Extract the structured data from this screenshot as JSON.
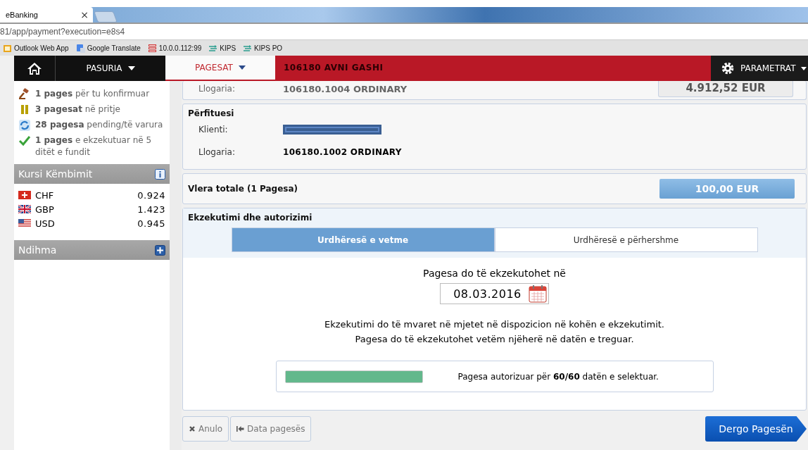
{
  "browser": {
    "tabs": [
      {
        "title": "eBanking",
        "close": "×",
        "selected": true
      }
    ],
    "url": "81/app/payment?execution=e8s4",
    "bookmarks": [
      {
        "label": "Outlook Web App",
        "kind": "mail"
      },
      {
        "label": "Google Translate",
        "kind": "translate"
      },
      {
        "label": "10.0.0.112:99",
        "kind": "server"
      },
      {
        "label": "KIPS",
        "kind": "kips"
      },
      {
        "label": "KIPS PO",
        "kind": "kips"
      }
    ]
  },
  "nav": {
    "items": [
      {
        "label": "PASURIA",
        "selected": false
      },
      {
        "label": "PAGESAT",
        "selected": true
      }
    ],
    "settings": "PARAMETRAT"
  },
  "sidebar": {
    "summary": [
      {
        "text": "**1 pages** për tu konfirmuar",
        "kind": "gavel"
      },
      {
        "text": "**3 pagesat** në pritje",
        "kind": "pause"
      },
      {
        "text": "**28 pagesa** pending/të varura",
        "kind": "sync"
      },
      {
        "text": "**1 pages** e ekzekutuar në 5 ditët e fundit",
        "kind": "check"
      }
    ],
    "rates": {
      "title": "Kursi Këmbimit",
      "rows": [
        {
          "currency": "CHF",
          "rate": "0.924",
          "kind": "ch"
        },
        {
          "currency": "GBP",
          "rate": "1.423",
          "kind": "gb"
        },
        {
          "currency": "USD",
          "rate": "0.945",
          "kind": "us"
        }
      ]
    },
    "help": {
      "title": "Ndihma"
    }
  },
  "payer": {
    "client": "106180 AVNI GASHI",
    "account_label": "Llogaria:",
    "account": "106180.1004 ORDINARY",
    "balance": "4.912,52 EUR"
  },
  "beneficiary": {
    "title": "Përfituesi",
    "client_label": "Klienti:",
    "account_label": "Llogaria:",
    "account": "106180.1002 ORDINARY"
  },
  "total": {
    "label": "Vlera totale (1 Pagesa)",
    "amount": "100,00 EUR"
  },
  "execution": {
    "title": "Ekzekutimi dhe autorizimi",
    "tabs": [
      {
        "label": "Urdhëresë e vetme",
        "selected": true
      },
      {
        "label": "Urdhëresë e përhershme",
        "selected": false
      }
    ],
    "date_label": "Pagesa do të ekzekutohet në",
    "date": "08.03.2016",
    "notes": [
      "Ekzekutimi do të mvaret në mjetet në dispozicion në kohën e ekzekutimit.",
      "Pagesa do të ekzekutohet vetëm njëherë në datën e treguar."
    ],
    "progress": {
      "level": 1,
      "text": "Pagesa autorizuar për **60/60** datën e selektuar."
    }
  },
  "buttons": [
    {
      "label": "Anulo",
      "kind": "cancel"
    },
    {
      "label": "Data pagesës",
      "kind": "back"
    },
    {
      "label": "Dergo Pagesën",
      "kind": "submit"
    }
  ]
}
